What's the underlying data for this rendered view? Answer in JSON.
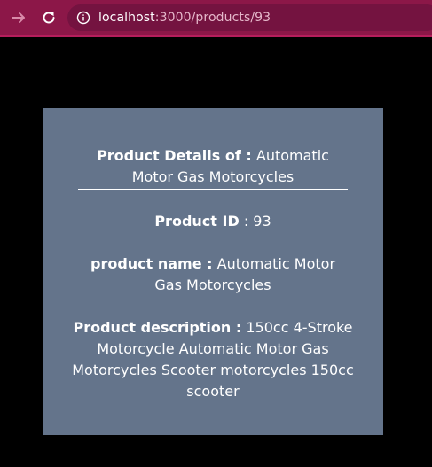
{
  "browser": {
    "url_host": "localhost",
    "url_rest": ":3000/products/93"
  },
  "product": {
    "title_label": "Product Details of :",
    "title_value": "Automatic Motor Gas Motorcycles",
    "id_label": "Product ID",
    "id_value": ": 93",
    "name_label": "product name :",
    "name_value": "Automatic Motor Gas Motorcycles",
    "description_label": "Product description :",
    "description_value": "150cc 4-Stroke Motorcycle Automatic Motor Gas Motorcycles Scooter motorcycles 150cc scooter"
  }
}
